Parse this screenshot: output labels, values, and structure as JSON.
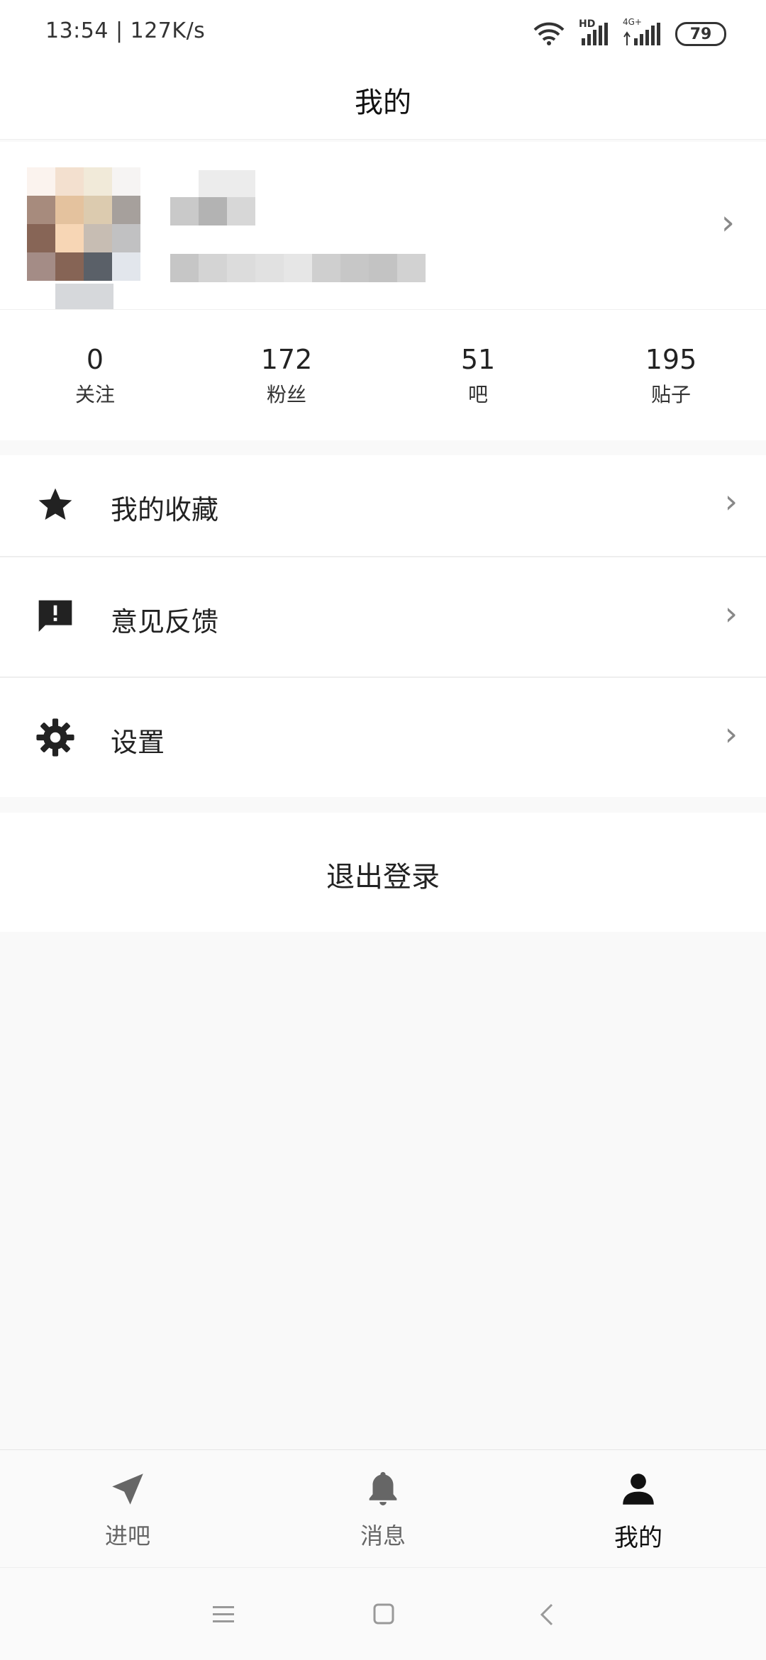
{
  "status_bar": {
    "time_speed": "13:54 | 127K/s",
    "network_hd": "HD",
    "network_4g": "4G+",
    "battery": "79"
  },
  "header": {
    "title": "我的"
  },
  "stats": [
    {
      "value": "0",
      "label": "关注"
    },
    {
      "value": "172",
      "label": "粉丝"
    },
    {
      "value": "51",
      "label": "吧"
    },
    {
      "value": "195",
      "label": "贴子"
    }
  ],
  "menu": {
    "favorites": "我的收藏",
    "feedback": "意见反馈",
    "settings": "设置"
  },
  "logout_label": "退出登录",
  "bottom_nav": [
    {
      "label": "进吧",
      "icon": "send-icon",
      "active": false
    },
    {
      "label": "消息",
      "icon": "bell-icon",
      "active": false
    },
    {
      "label": "我的",
      "icon": "person-icon",
      "active": true
    }
  ],
  "colors": {
    "background": "#f9f9f9",
    "surface": "#ffffff",
    "text_primary": "#212121",
    "inactive_nav": "#666666",
    "active_nav": "#111111"
  }
}
